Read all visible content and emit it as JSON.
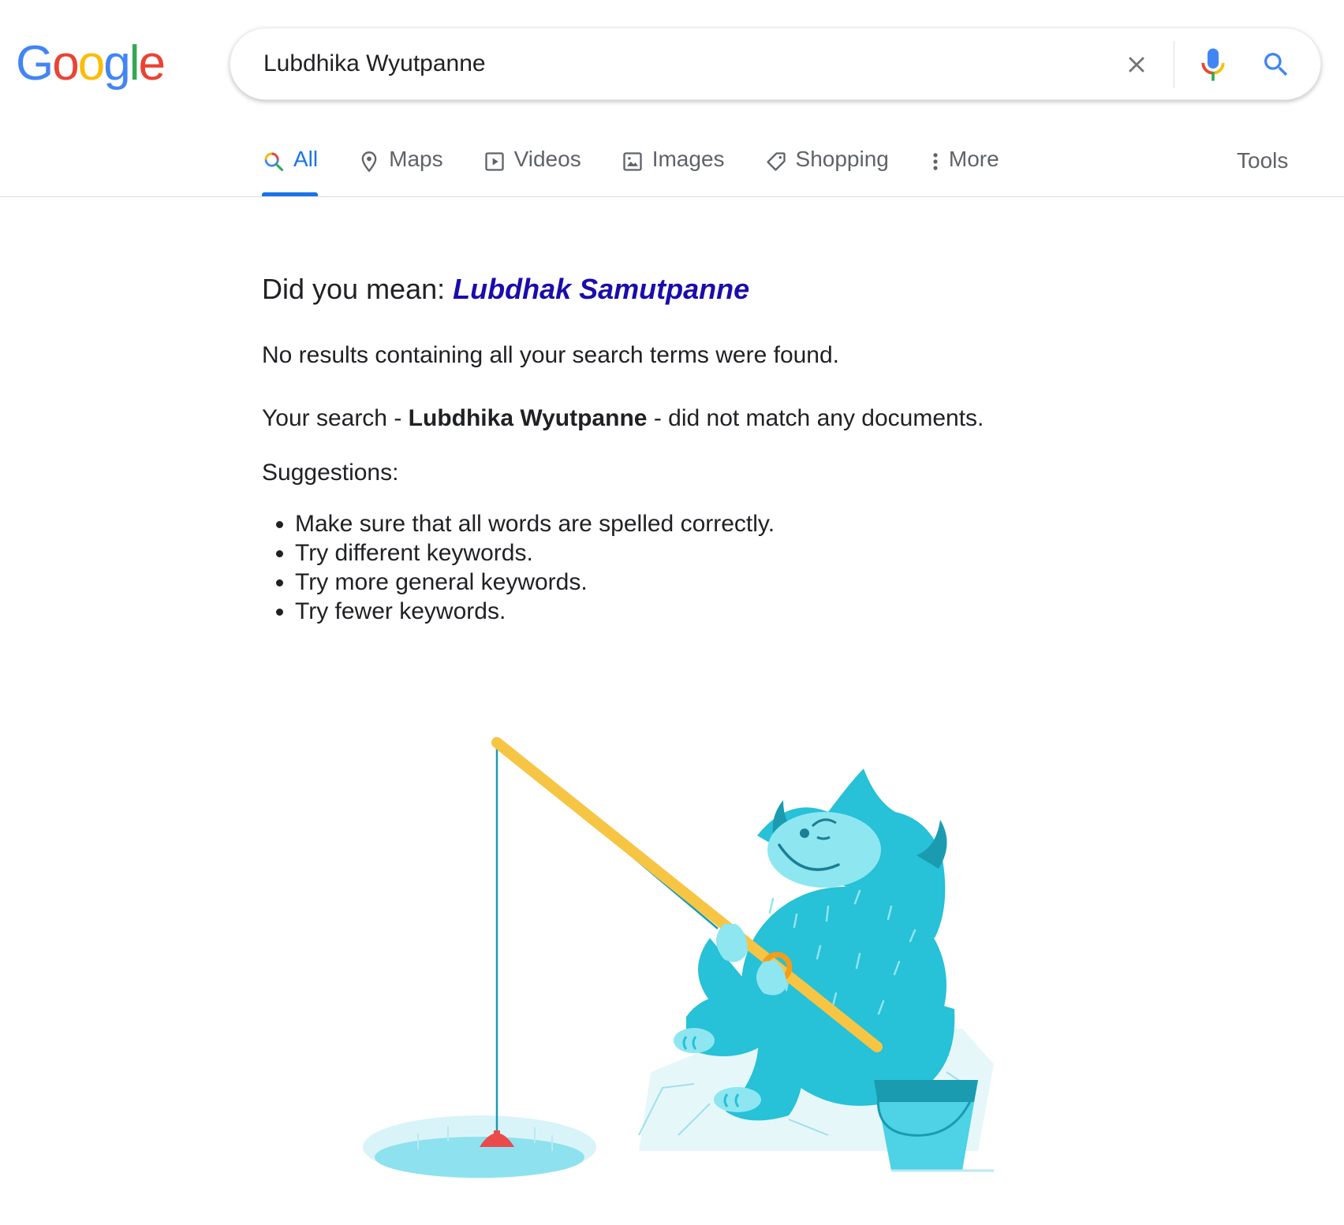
{
  "logo": {
    "letters": [
      "G",
      "o",
      "o",
      "g",
      "l",
      "e"
    ],
    "colors": [
      "#4285F4",
      "#EA4335",
      "#FBBC05",
      "#4285F4",
      "#34A853",
      "#EA4335"
    ]
  },
  "search": {
    "value": "Lubdhika Wyutpanne",
    "clear_icon": "close-icon",
    "mic_icon": "microphone-icon",
    "search_icon": "search-icon"
  },
  "tabs": [
    {
      "label": "All",
      "icon": "search-icon",
      "active": true
    },
    {
      "label": "Maps",
      "icon": "map-pin-icon",
      "active": false
    },
    {
      "label": "Videos",
      "icon": "play-icon",
      "active": false
    },
    {
      "label": "Images",
      "icon": "image-icon",
      "active": false
    },
    {
      "label": "Shopping",
      "icon": "tag-icon",
      "active": false
    },
    {
      "label": "More",
      "icon": "more-vert-icon",
      "active": false
    }
  ],
  "tools_label": "Tools",
  "results": {
    "did_you_mean_prefix": "Did you mean:",
    "did_you_mean_suggestion": "Lubdhak Samutpanne",
    "no_results": "No results containing all your search terms were found.",
    "your_search_prefix": "Your search -",
    "your_search_query": "Lubdhika Wyutpanne",
    "your_search_suffix": "- did not match any documents.",
    "suggestions_title": "Suggestions:",
    "suggestions": [
      "Make sure that all words are spelled correctly.",
      "Try different keywords.",
      "Try more general keywords.",
      "Try fewer keywords."
    ]
  },
  "colors": {
    "accent": "#1a73e8",
    "link": "#1a0dab",
    "text": "#202124",
    "muted": "#5f6368"
  }
}
